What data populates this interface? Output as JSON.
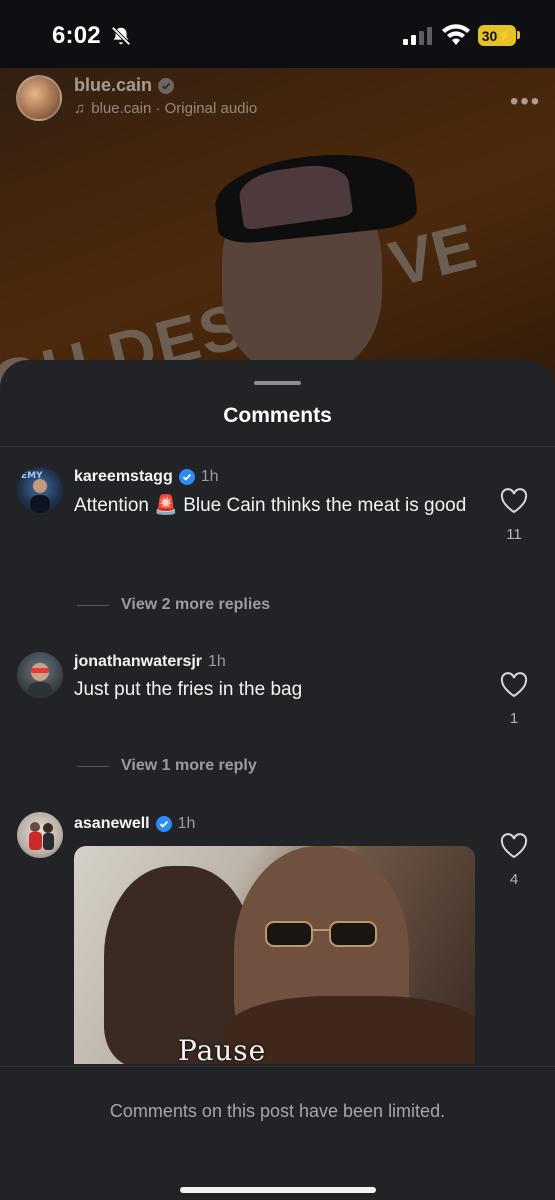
{
  "status_bar": {
    "time": "6:02",
    "battery": "30"
  },
  "post": {
    "username": "blue.cain",
    "audio": "blue.cain · Original audio",
    "more": "•••"
  },
  "sheet": {
    "title": "Comments",
    "footer": "Comments on this post have been limited."
  },
  "comments": [
    {
      "username": "kareemstagg",
      "verified": true,
      "time": "1h",
      "text": "Attention 🚨 Blue Cain thinks the meat is good",
      "likes": "11",
      "replies_label": "View 2 more replies"
    },
    {
      "username": "jonathanwatersjr",
      "verified": false,
      "time": "1h",
      "text": "Just put the fries in the bag",
      "likes": "1",
      "replies_label": "View 1 more reply"
    },
    {
      "username": "asanewell",
      "verified": true,
      "time": "1h",
      "gif_caption": "Pause",
      "likes": "4"
    }
  ],
  "colors": {
    "sheet_bg": "#212327",
    "verified_blue": "#2f8cf5",
    "battery_yellow": "#e6c229"
  }
}
